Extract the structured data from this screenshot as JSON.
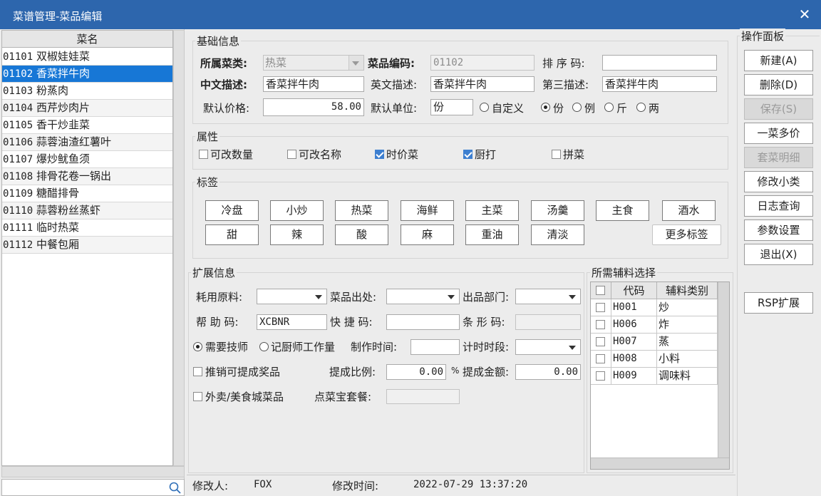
{
  "window": {
    "title": "菜谱管理-菜品编辑",
    "close_symbol": "✕"
  },
  "dish_list": {
    "header": "菜名",
    "selected_index": 1,
    "items": [
      {
        "code": "01101",
        "name": "双椒娃娃菜"
      },
      {
        "code": "01102",
        "name": "香菜拌牛肉"
      },
      {
        "code": "01103",
        "name": "粉蒸肉"
      },
      {
        "code": "01104",
        "name": "西芹炒肉片"
      },
      {
        "code": "01105",
        "name": "香干炒韭菜"
      },
      {
        "code": "01106",
        "name": "蒜蓉油渣红薯叶"
      },
      {
        "code": "01107",
        "name": "爆炒鱿鱼须"
      },
      {
        "code": "01108",
        "name": "排骨花卷一锅出"
      },
      {
        "code": "01109",
        "name": "糖醋排骨"
      },
      {
        "code": "01110",
        "name": "蒜蓉粉丝蒸虾"
      },
      {
        "code": "01111",
        "name": "临时热菜"
      },
      {
        "code": "01112",
        "name": "中餐包厢"
      }
    ],
    "search_value": ""
  },
  "basic": {
    "group_title": "基础信息",
    "category_label": "所属菜类:",
    "category_value": "热菜",
    "code_label": "菜品编码:",
    "code_value": "01102",
    "sort_label": "排 序 码:",
    "sort_value": "",
    "cn_desc_label": "中文描述:",
    "cn_desc_value": "香菜拌牛肉",
    "en_desc_label": "英文描述:",
    "en_desc_value": "香菜拌牛肉",
    "third_desc_label": "第三描述:",
    "third_desc_value": "香菜拌牛肉",
    "price_label": "默认价格:",
    "price_value": "58.00",
    "unit_label": "默认单位:",
    "unit_value": "份",
    "unit_options": [
      {
        "label": "自定义",
        "checked": false
      },
      {
        "label": "份",
        "checked": true
      },
      {
        "label": "例",
        "checked": false
      },
      {
        "label": "斤",
        "checked": false
      },
      {
        "label": "两",
        "checked": false
      }
    ]
  },
  "attributes": {
    "group_title": "属性",
    "items": [
      {
        "label": "可改数量",
        "checked": false
      },
      {
        "label": "可改名称",
        "checked": false
      },
      {
        "label": "时价菜",
        "checked": true
      },
      {
        "label": "厨打",
        "checked": true
      },
      {
        "label": "拼菜",
        "checked": false
      }
    ]
  },
  "tags": {
    "group_title": "标签",
    "row1": [
      "冷盘",
      "小炒",
      "热菜",
      "海鲜",
      "主菜",
      "汤羹",
      "主食",
      "酒水"
    ],
    "row2": [
      "甜",
      "辣",
      "酸",
      "麻",
      "重油",
      "清淡"
    ],
    "more_label": "更多标签"
  },
  "extended": {
    "group_title": "扩展信息",
    "raw_material_label": "耗用原料:",
    "raw_material_value": "",
    "origin_label": "菜品出处:",
    "origin_value": "",
    "dept_label": "出品部门:",
    "dept_value": "",
    "helper_code_label": "帮 助 码:",
    "helper_code_value": "XCBNR",
    "quick_code_label": "快 捷 码:",
    "quick_code_value": "",
    "barcode_label": "条 形 码:",
    "barcode_value": "",
    "need_chef_label": "需要技师",
    "need_chef_checked": true,
    "chef_workload_label": "记厨师工作量",
    "chef_workload_checked": false,
    "make_time_label": "制作时间:",
    "make_time_value": "",
    "timing_label": "计时时段:",
    "timing_value": "",
    "promo_label": "推销可提成奖品",
    "promo_checked": false,
    "ratio_label": "提成比例:",
    "ratio_value": "0.00",
    "ratio_unit": "%",
    "amount_label": "提成金额:",
    "amount_value": "0.00",
    "takeout_label": "外卖/美食城菜品",
    "takeout_checked": false,
    "combo_label": "点菜宝套餐:",
    "combo_value": ""
  },
  "aux": {
    "group_title": "所需辅料选择",
    "col_code": "代码",
    "col_type": "辅料类别",
    "rows": [
      {
        "code": "H001",
        "type": "炒"
      },
      {
        "code": "H006",
        "type": "炸"
      },
      {
        "code": "H007",
        "type": "蒸"
      },
      {
        "code": "H008",
        "type": "小料"
      },
      {
        "code": "H009",
        "type": "调味料"
      }
    ]
  },
  "ops": {
    "group_title": "操作面板",
    "new": "新建(A)",
    "delete": "删除(D)",
    "save": "保存(S)",
    "multi_price": "一菜多价",
    "set_detail": "套菜明细",
    "modify_subclass": "修改小类",
    "log_query": "日志查询",
    "param_settings": "参数设置",
    "exit": "退出(X)",
    "rsp": "RSP扩展"
  },
  "status": {
    "modifier_label": "修改人:",
    "modifier_value": "FOX",
    "modify_time_label": "修改时间:",
    "modify_time_value": "2022-07-29 13:37:20"
  }
}
